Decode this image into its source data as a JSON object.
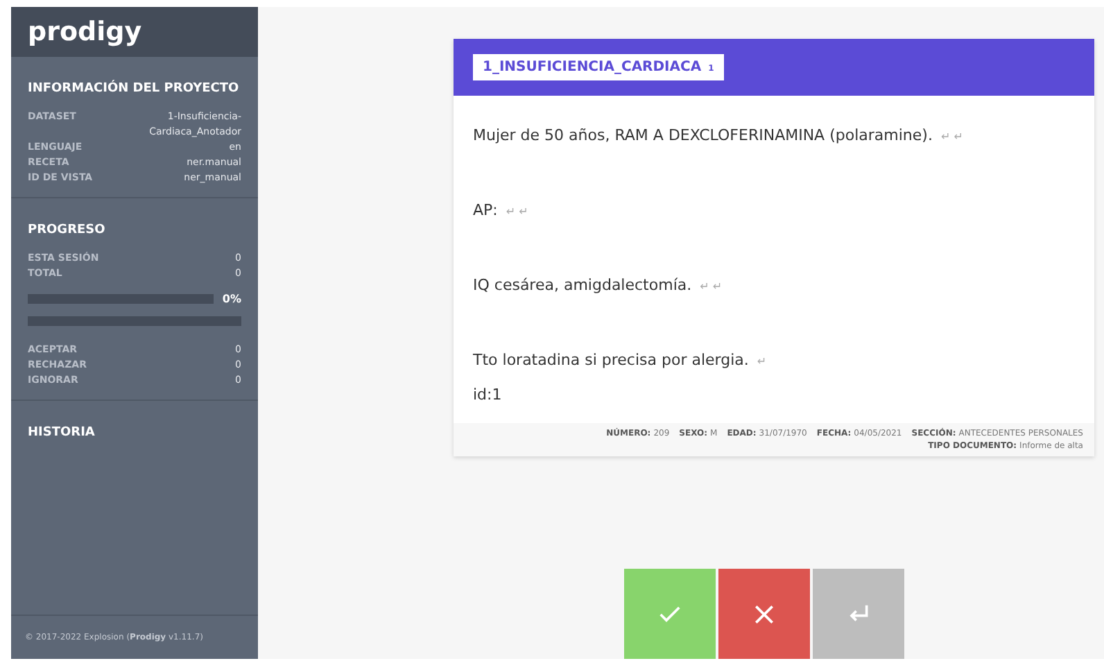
{
  "sidebar": {
    "logo": "prodigy",
    "project": {
      "title": "INFORMACIÓN DEL PROYECTO",
      "rows": [
        {
          "label": "DATASET",
          "value": "1-Insuficiencia-Cardiaca_Anotador"
        },
        {
          "label": "LENGUAJE",
          "value": "en"
        },
        {
          "label": "RECETA",
          "value": "ner.manual"
        },
        {
          "label": "ID DE VISTA",
          "value": "ner_manual"
        }
      ]
    },
    "progress": {
      "title": "PROGRESO",
      "rows": [
        {
          "label": "ESTA SESIÓN",
          "value": "0"
        },
        {
          "label": "TOTAL",
          "value": "0"
        }
      ],
      "bar": {
        "level": 0,
        "reading": "0%"
      },
      "bar2": {
        "level": 0
      },
      "counts": [
        {
          "label": "ACEPTAR",
          "value": "0"
        },
        {
          "label": "RECHAZAR",
          "value": "0"
        },
        {
          "label": "IGNORAR",
          "value": "0"
        }
      ]
    },
    "history": {
      "title": "HISTORIA"
    },
    "footer": {
      "copyright": "© 2017-2022 Explosion",
      "version": "(**Prodigy** v1.11.7)"
    }
  },
  "card": {
    "label": "1_INSUFICIENCIA_CARDIACA",
    "label_count": "1",
    "paragraphs": [
      {
        "text": "Mujer de 50 años, RAM A DEXCLOFERINAMINA (polaramine).",
        "newlines": "↵ ↵"
      },
      {
        "text": "AP:",
        "newlines": "↵ ↵"
      },
      {
        "text": "IQ cesárea, amigdalectomía.",
        "newlines": "↵ ↵"
      },
      {
        "text": "Tto loratadina si precisa por alergia.",
        "newlines": "↵"
      }
    ],
    "id": "id:1",
    "meta": [
      {
        "label": "NÚMERO:",
        "value": "209"
      },
      {
        "label": "SEXO:",
        "value": "M"
      },
      {
        "label": "EDAD:",
        "value": "31/07/1970"
      },
      {
        "label": "FECHA:",
        "value": "04/05/2021"
      },
      {
        "label": "SECCIÓN:",
        "value": "ANTECEDENTES PERSONALES"
      },
      {
        "label": "TIPO DOCUMENTO:",
        "value": "Informe de alta"
      }
    ]
  },
  "actions": [
    {
      "kind": "accept"
    },
    {
      "kind": "reject"
    },
    {
      "kind": "ignore"
    }
  ]
}
